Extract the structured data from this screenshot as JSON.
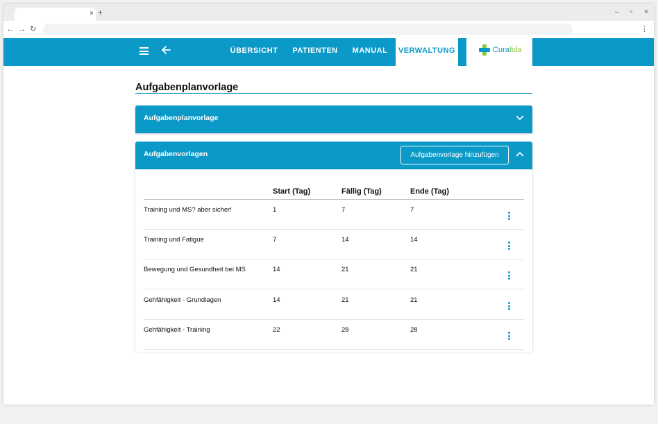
{
  "colors": {
    "accent": "#0b99c7",
    "logo_secondary": "#8bc53f"
  },
  "browser": {
    "tab_close_glyph": "×",
    "new_tab_glyph": "+",
    "win_minimize": "–",
    "win_restore": "▫",
    "win_close": "×",
    "back_glyph": "←",
    "forward_glyph": "→",
    "reload_glyph": "↻",
    "menu_glyph": "⋮"
  },
  "header": {
    "nav": [
      {
        "label": "ÜBERSICHT"
      },
      {
        "label": "PATIENTEN"
      },
      {
        "label": "MANUAL"
      },
      {
        "label": "VERWALTUNG"
      }
    ],
    "logo": {
      "part1": "Cura",
      "part2": "fida"
    }
  },
  "page": {
    "title": "Aufgabenplanvorlage"
  },
  "panels": {
    "template": {
      "label": "Aufgabenplanvorlage"
    },
    "tasks": {
      "label": "Aufgabenvorlagen",
      "add_button": "Aufgabenvorlage hinzufügen",
      "columns": [
        "",
        "Start (Tag)",
        "Fällig (Tag)",
        "Ende (Tag)"
      ],
      "rows": [
        {
          "name": "Training und MS? aber sicher!",
          "start": "1",
          "due": "7",
          "end": "7"
        },
        {
          "name": "Training und Fatigue",
          "start": "7",
          "due": "14",
          "end": "14"
        },
        {
          "name": "Bewegung und Gesundheit bei MS",
          "start": "14",
          "due": "21",
          "end": "21"
        },
        {
          "name": "Gehfähigkeit - Grundlagen",
          "start": "14",
          "due": "21",
          "end": "21"
        },
        {
          "name": "Gehfähigkeit - Training",
          "start": "22",
          "due": "28",
          "end": "28"
        }
      ]
    }
  }
}
